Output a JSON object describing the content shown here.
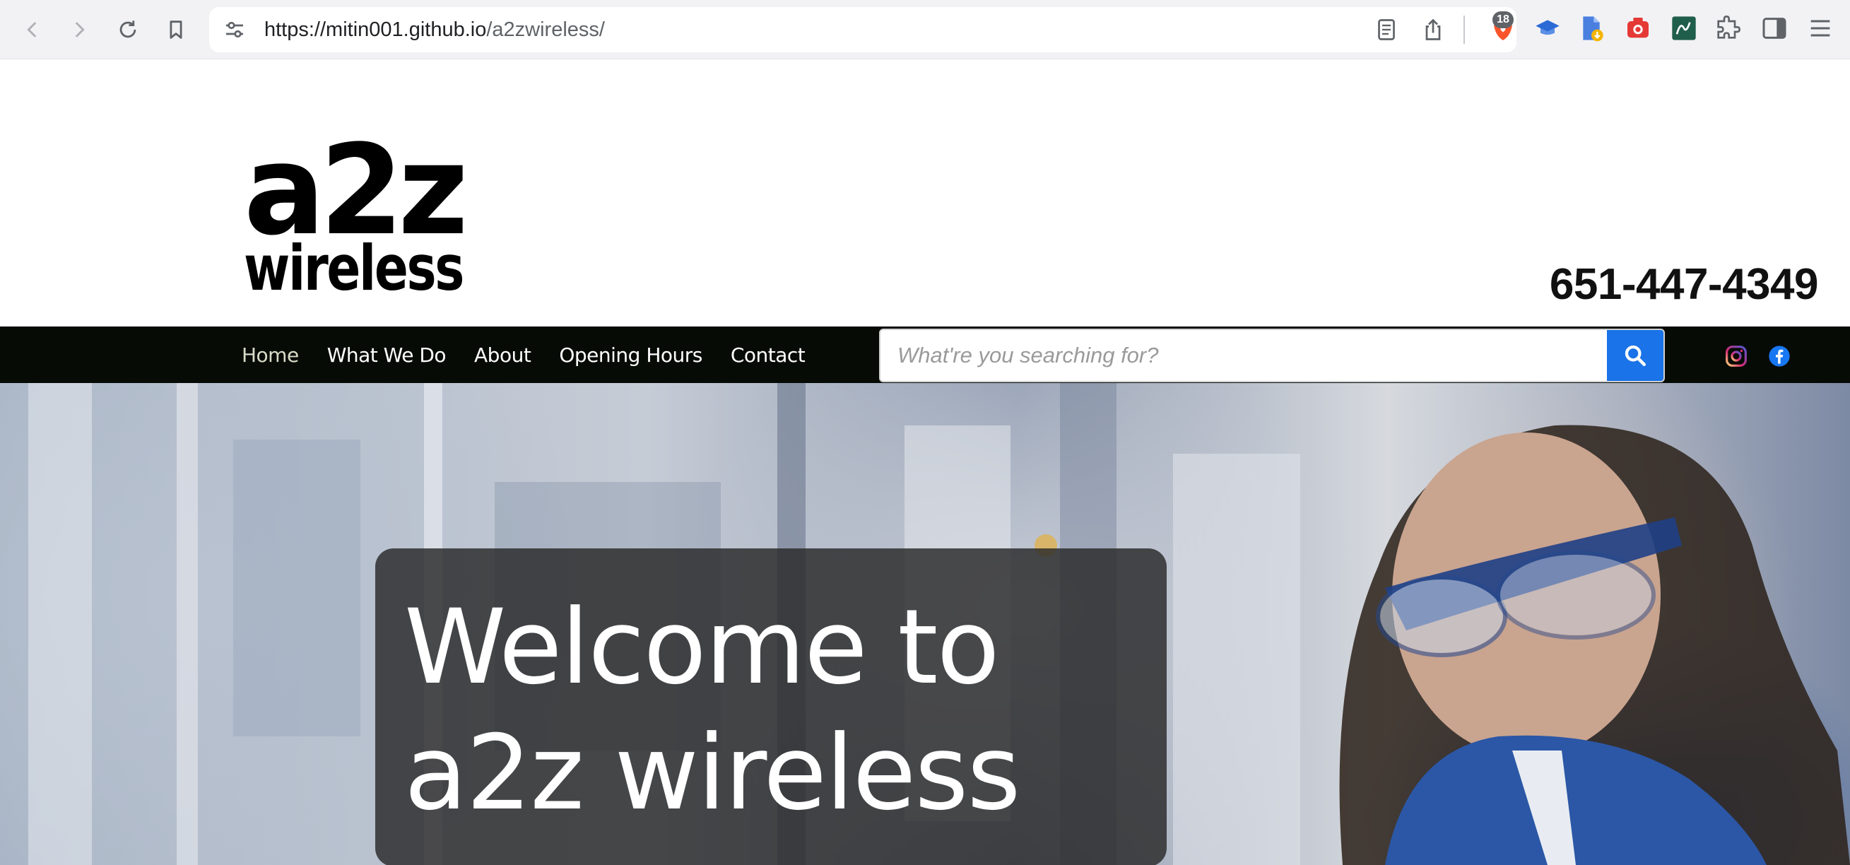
{
  "browser": {
    "url_host": "https://mitin001.github.io",
    "url_path": "/a2zwireless/",
    "shields_count": "18"
  },
  "header": {
    "logo_text_top": "a2z",
    "logo_text_bottom": "wireless",
    "phone": "651-447-4349"
  },
  "nav": {
    "items": [
      {
        "label": "Home",
        "active": true
      },
      {
        "label": "What We Do"
      },
      {
        "label": "About"
      },
      {
        "label": "Opening Hours"
      },
      {
        "label": "Contact"
      }
    ],
    "search_placeholder": "What're you searching for?"
  },
  "hero": {
    "title_line1": "Welcome to",
    "title_line2": "a2z wireless"
  },
  "colors": {
    "navbar_bg": "#070b05",
    "search_button": "#1a73e8",
    "hero_overlay": "#282828"
  }
}
